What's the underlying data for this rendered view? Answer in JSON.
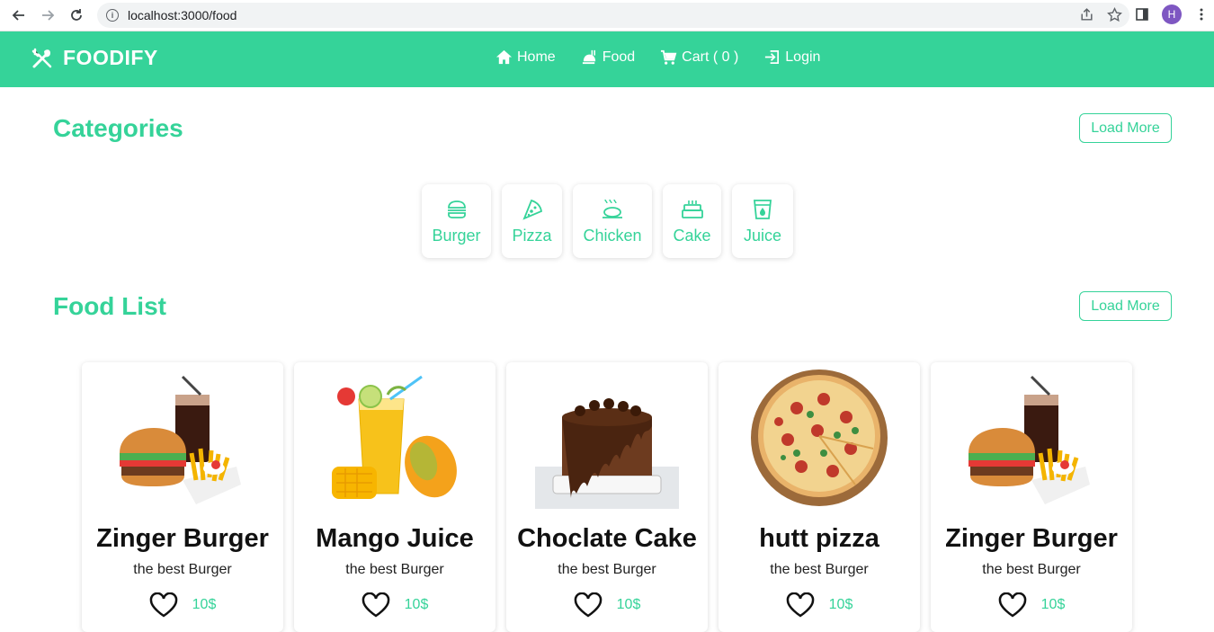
{
  "browser": {
    "url": "localhost:3000/food",
    "avatar_letter": "H"
  },
  "header": {
    "brand": "FOODIFY",
    "menu": [
      {
        "label": "Home",
        "icon": "home-icon"
      },
      {
        "label": "Food",
        "icon": "food-icon"
      },
      {
        "label": "Cart ( 0 )",
        "icon": "cart-icon"
      },
      {
        "label": "Login",
        "icon": "login-icon"
      }
    ]
  },
  "categories": {
    "title": "Categories",
    "load_more": "Load More",
    "items": [
      {
        "label": "Burger",
        "icon": "burger-icon"
      },
      {
        "label": "Pizza",
        "icon": "pizza-icon"
      },
      {
        "label": "Chicken",
        "icon": "chicken-icon"
      },
      {
        "label": "Cake",
        "icon": "cake-icon"
      },
      {
        "label": "Juice",
        "icon": "juice-icon"
      }
    ]
  },
  "food_list": {
    "title": "Food List",
    "load_more": "Load More",
    "items": [
      {
        "name": "Zinger Burger",
        "desc": "the best Burger",
        "price": "10$",
        "image": "burger-combo"
      },
      {
        "name": "Mango Juice",
        "desc": "the best Burger",
        "price": "10$",
        "image": "mango-juice"
      },
      {
        "name": "Choclate Cake",
        "desc": "the best Burger",
        "price": "10$",
        "image": "chocolate-cake"
      },
      {
        "name": "hutt pizza",
        "desc": "the best Burger",
        "price": "10$",
        "image": "pizza"
      },
      {
        "name": "Zinger Burger",
        "desc": "the best Burger",
        "price": "10$",
        "image": "burger-combo"
      }
    ]
  },
  "colors": {
    "accent": "#35d399"
  }
}
